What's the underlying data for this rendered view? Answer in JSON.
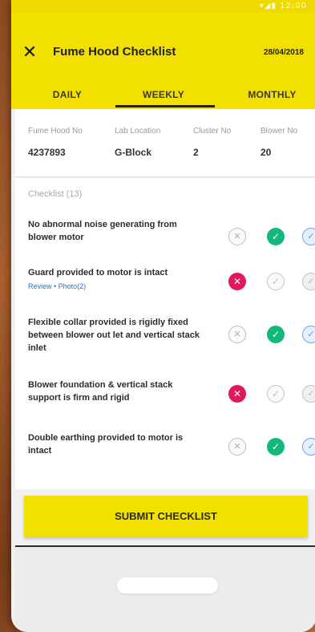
{
  "status_bar": {
    "icons": "▾◢▮ 12:00"
  },
  "header": {
    "title": "Fume Hood Checklist",
    "date": "28/04/2018",
    "close_icon": "close-icon"
  },
  "tabs": [
    {
      "label": "DAILY",
      "active": false
    },
    {
      "label": "WEEKLY",
      "active": true
    },
    {
      "label": "MONTHLY",
      "active": false
    }
  ],
  "info": {
    "fume_hood_no": {
      "label": "Fume Hood No",
      "value": "4237893"
    },
    "lab_location": {
      "label": "Lab Location",
      "value": "G-Block"
    },
    "cluster_no": {
      "label": "Cluster No",
      "value": "2"
    },
    "blower_no": {
      "label": "Blower No",
      "value": "20"
    }
  },
  "checklist": {
    "title": "Checklist (13)",
    "items": [
      {
        "text": "No abnormal  noise generating from blower motor",
        "status": "ok"
      },
      {
        "text": "Guard provided to motor is intact",
        "status": "fail",
        "links": "Review  •  Photo(2)"
      },
      {
        "text": "Flexible collar provided is rigidly fixed between blower out let and vertical stack inlet",
        "status": "ok"
      },
      {
        "text": "Blower foundation & vertical stack support is firm and rigid",
        "status": "fail"
      },
      {
        "text": "Double earthing provided to motor is intact",
        "status": "ok"
      }
    ]
  },
  "submit_label": "SUBMIT CHECKLIST",
  "colors": {
    "accent_yellow": "#f2e000",
    "ok_green": "#14b87a",
    "fail_red": "#e0185c",
    "na_blue": "#5b9ce6"
  }
}
